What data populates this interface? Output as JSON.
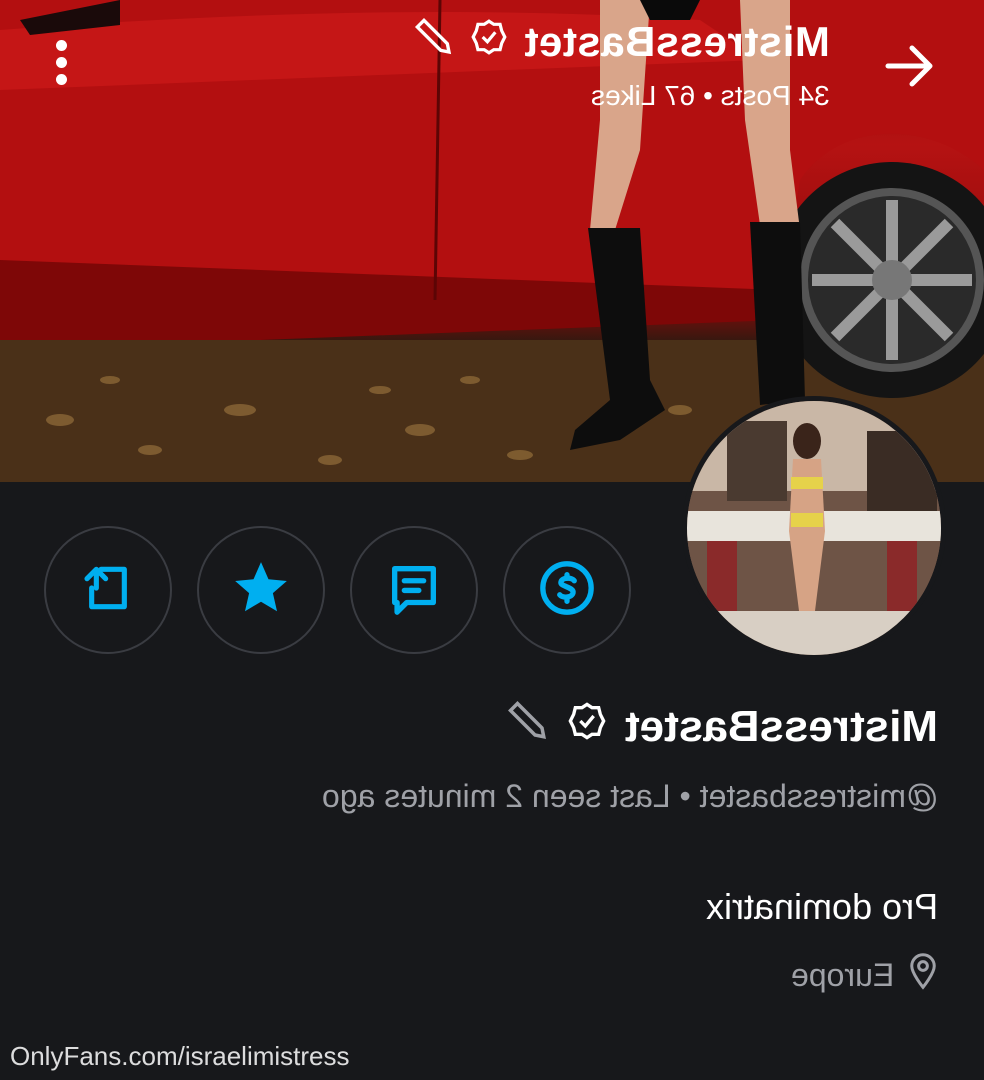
{
  "header": {
    "display_name": "MistressBastet",
    "stats": "34 Posts • 67 Likes"
  },
  "profile": {
    "display_name": "MistressBastet",
    "handle_line": "@mistressbastet • Last seen 2 minutes ago",
    "bio": "Pro dominatrix",
    "location": "Europe"
  },
  "actions": {
    "icons": [
      "share-icon",
      "star-icon",
      "message-icon",
      "tip-icon"
    ]
  },
  "colors": {
    "accent": "#00aff0",
    "background": "#17181b",
    "muted_text": "#9fa1a7"
  },
  "watermark": "OnlyFans.com/israelimistress"
}
